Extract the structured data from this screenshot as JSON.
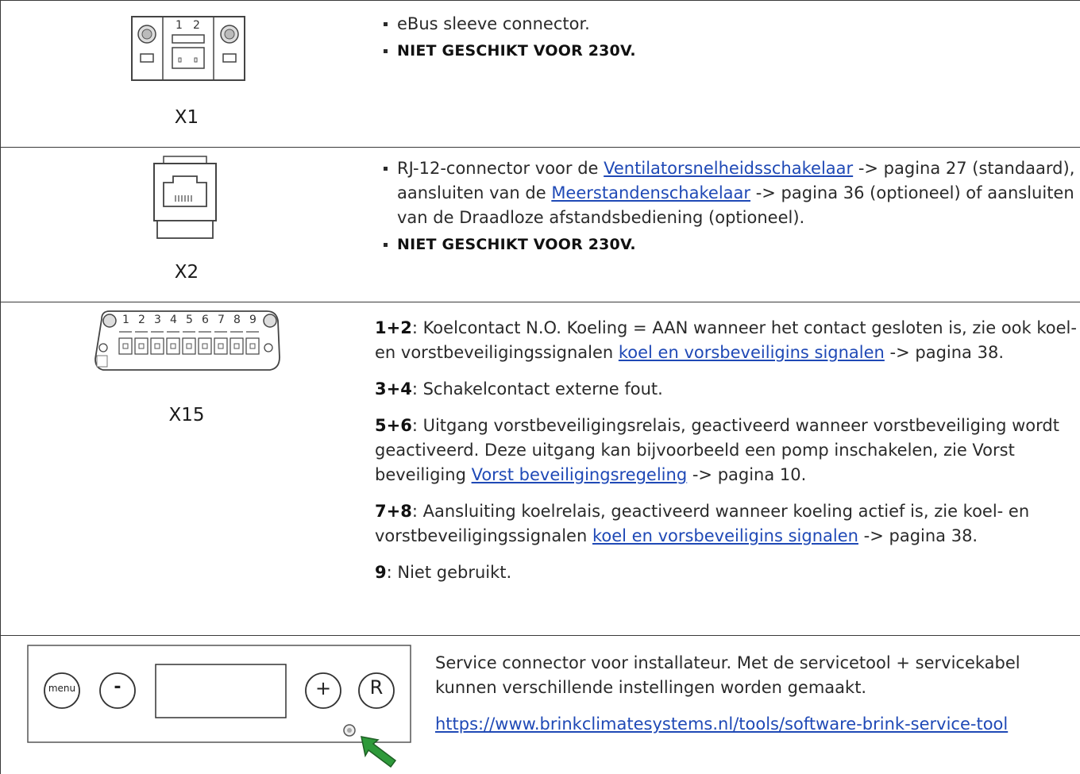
{
  "rows": [
    {
      "caption": "X1",
      "bullets": [
        {
          "text": "eBus sleeve connector."
        },
        {
          "warning": "NIET GESCHIKT VOOR 230V."
        }
      ]
    },
    {
      "caption": "X2",
      "desc": {
        "p1": "RJ-12-connector voor de ",
        "link1": "Ventilatorsnelheidsschakelaar",
        "p2": " -> pagina 27 (standaard), aansluiten van de ",
        "link2": "Meerstandenschakelaar",
        "p3": " -> pagina 36 (optioneel) of aansluiten van de Draadloze afstandsbediening (optioneel)."
      },
      "warning": "NIET GESCHIKT VOOR 230V."
    },
    {
      "caption": "X15",
      "connector_numbers": [
        "1",
        "2",
        "3",
        "4",
        "5",
        "6",
        "7",
        "8",
        "9"
      ],
      "items": {
        "i12": {
          "key": "1+2",
          "t1": ": Koelcontact N.O. Koeling = AAN wanneer het contact gesloten is, zie ook koel- en vorstbeveiligingssignalen ",
          "link": "koel en vorsbeveiligins signalen",
          "t2": " -> pagina 38."
        },
        "i34": {
          "key": "3+4",
          "t1": ": Schakelcontact externe fout."
        },
        "i56": {
          "key": "5+6",
          "t1": ": Uitgang vorstbeveiligingsrelais, geactiveerd wanneer vorstbeveiliging wordt geactiveerd. Deze uitgang kan bijvoorbeeld een pomp inschakelen, zie Vorst beveiliging ",
          "link": "Vorst beveiligingsregeling",
          "t2": " -> pagina 10."
        },
        "i78": {
          "key": "7+8",
          "t1": ": Aansluiting koelrelais, geactiveerd wanneer koeling actief is, zie koel- en vorstbeveiligingssignalen ",
          "link": "koel en vorsbeveiligins signalen",
          "t2": " -> pagina 38."
        },
        "i9": {
          "key": "9",
          "t1": ": Niet gebruikt."
        }
      }
    },
    {
      "panel": {
        "menu": "menu",
        "minus": "-",
        "plus": "+",
        "reset": "R"
      },
      "text": "Service connector voor installateur. Met de servicetool + servicekabel kunnen verschillende instellingen worden gemaakt.",
      "link": "https://www.brinkclimatesystems.nl/tools/software-brink-service-tool"
    }
  ],
  "colors": {
    "link": "#1f49b6",
    "arrow": "#2e9a3a",
    "border": "#3a3a3a"
  }
}
